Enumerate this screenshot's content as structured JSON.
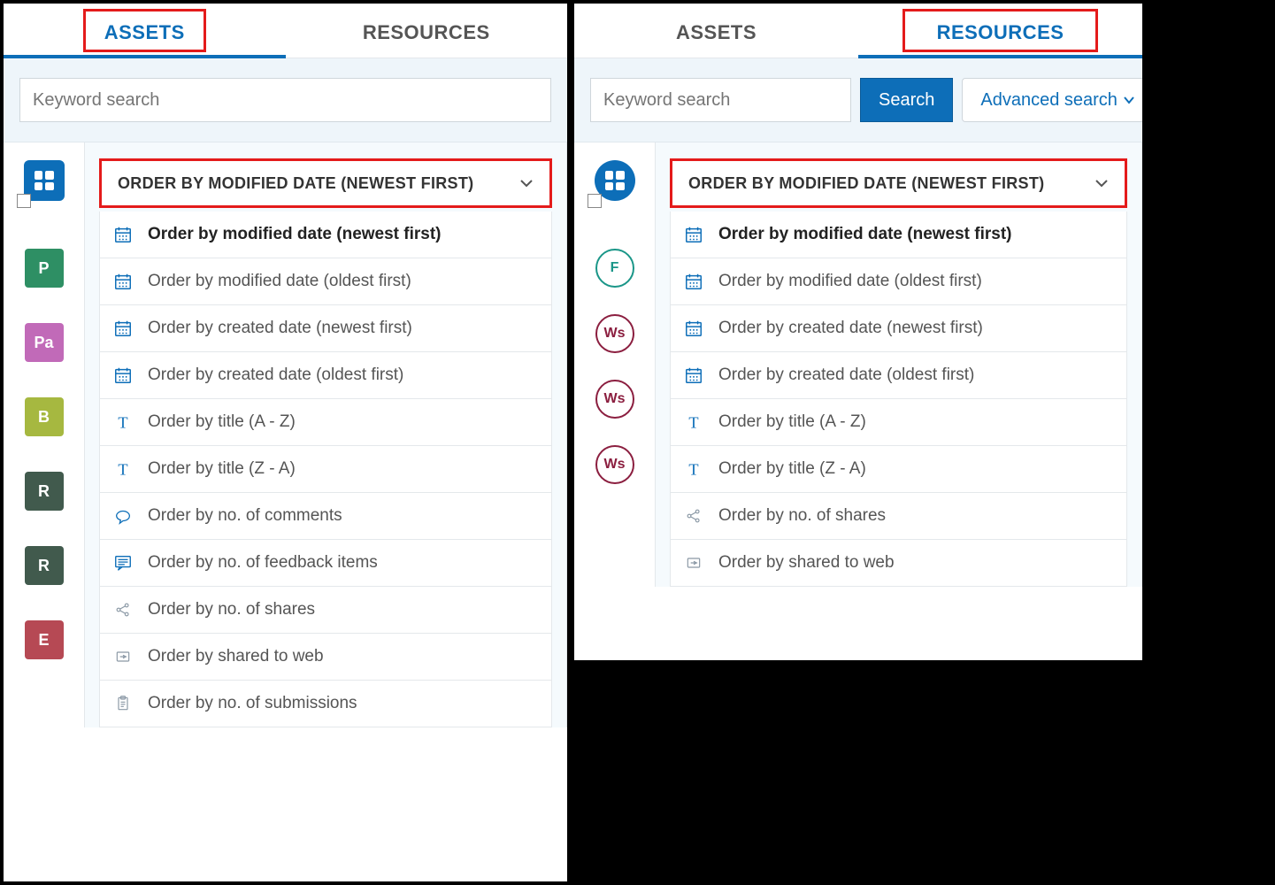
{
  "left": {
    "tabs": {
      "assets": "ASSETS",
      "resources": "RESOURCES",
      "activeIndex": 0
    },
    "search": {
      "placeholder": "Keyword search"
    },
    "sortTrigger": "ORDER BY MODIFIED DATE (NEWEST FIRST)",
    "sortOptions": [
      {
        "label": "Order by modified date (newest first)",
        "icon": "calendar",
        "selected": true
      },
      {
        "label": "Order by modified date (oldest first)",
        "icon": "calendar"
      },
      {
        "label": "Order by created date (newest first)",
        "icon": "calendar"
      },
      {
        "label": "Order by created date (oldest first)",
        "icon": "calendar"
      },
      {
        "label": "Order by title (A - Z)",
        "icon": "T"
      },
      {
        "label": "Order by title (Z - A)",
        "icon": "T"
      },
      {
        "label": "Order by no. of comments",
        "icon": "comment"
      },
      {
        "label": "Order by no. of feedback items",
        "icon": "feedback"
      },
      {
        "label": "Order by no. of shares",
        "icon": "share"
      },
      {
        "label": "Order by shared to web",
        "icon": "sharedweb"
      },
      {
        "label": "Order by no. of submissions",
        "icon": "clipboard"
      }
    ],
    "sideBadges": [
      {
        "text": "P",
        "color": "#2e8f64"
      },
      {
        "text": "Pa",
        "color": "#c16ab8"
      },
      {
        "text": "B",
        "color": "#a6b840"
      },
      {
        "text": "R",
        "color": "#415a4d"
      },
      {
        "text": "R",
        "color": "#415a4d"
      },
      {
        "text": "E",
        "color": "#b64954"
      }
    ]
  },
  "right": {
    "tabs": {
      "assets": "ASSETS",
      "resources": "RESOURCES",
      "activeIndex": 1
    },
    "search": {
      "placeholder": "Keyword search",
      "searchBtn": "Search",
      "advanced": "Advanced search"
    },
    "sortTrigger": "ORDER BY MODIFIED DATE (NEWEST FIRST)",
    "sortOptions": [
      {
        "label": "Order by modified date (newest first)",
        "icon": "calendar",
        "selected": true
      },
      {
        "label": "Order by modified date (oldest first)",
        "icon": "calendar"
      },
      {
        "label": "Order by created date (newest first)",
        "icon": "calendar"
      },
      {
        "label": "Order by created date (oldest first)",
        "icon": "calendar"
      },
      {
        "label": "Order by title (A - Z)",
        "icon": "T"
      },
      {
        "label": "Order by title (Z - A)",
        "icon": "T"
      },
      {
        "label": "Order by no. of shares",
        "icon": "share"
      },
      {
        "label": "Order by shared to web",
        "icon": "sharedweb"
      }
    ],
    "sideBadges": [
      {
        "text": "F",
        "style": "teal"
      },
      {
        "text": "Ws",
        "style": "maroon"
      },
      {
        "text": "Ws",
        "style": "maroon"
      },
      {
        "text": "Ws",
        "style": "maroon"
      }
    ]
  }
}
